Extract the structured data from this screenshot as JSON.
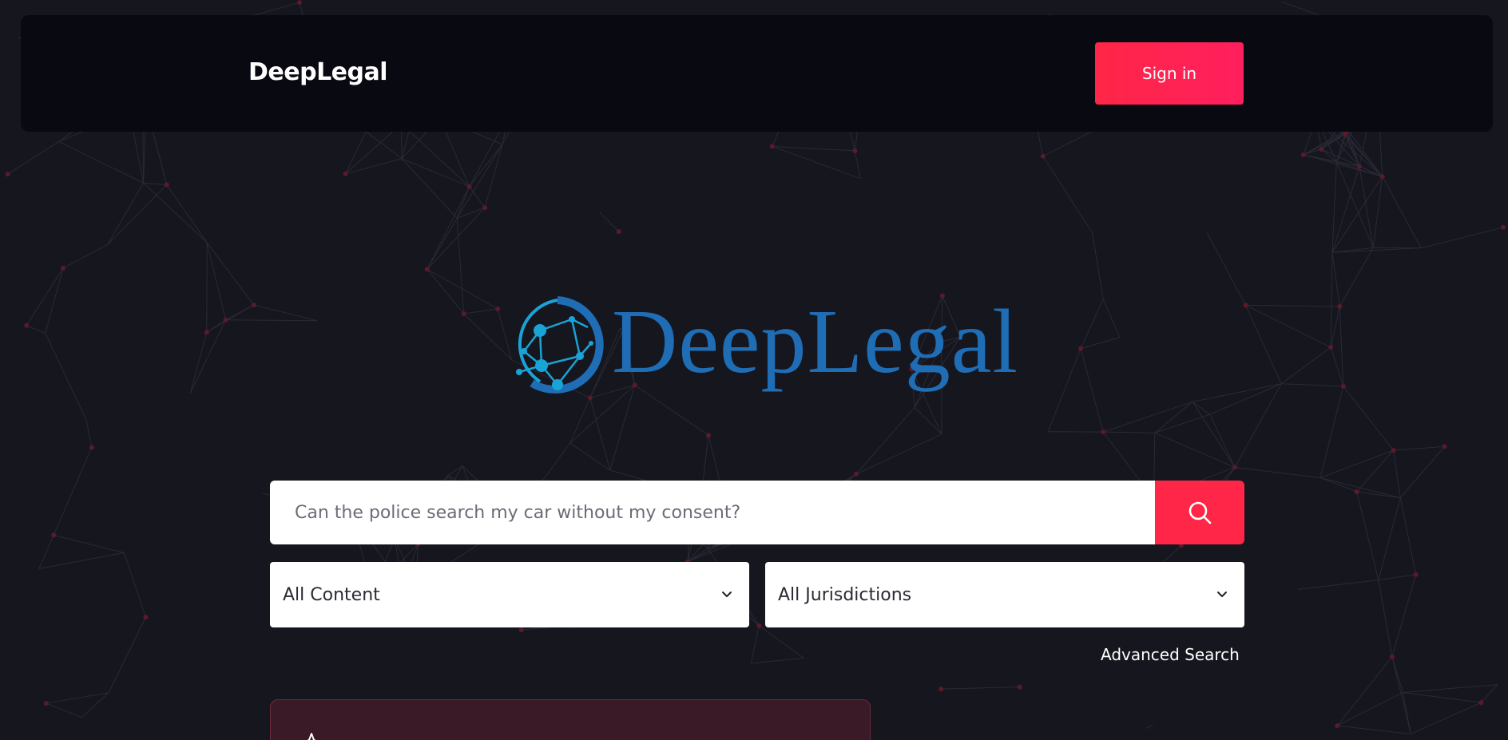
{
  "nav": {
    "brand": "DeepLegal",
    "signin_label": "Sign in"
  },
  "logo": {
    "text": "DeepLegal",
    "color": "#1f6db5",
    "accent": "#1aa3d6"
  },
  "search": {
    "placeholder": "Can the police search my car without my consent?",
    "value": "",
    "button_icon": "search-icon"
  },
  "filters": {
    "content": {
      "selected": "All Content",
      "icon": "chevron-down-icon"
    },
    "jurisdiction": {
      "selected": "All Jurisdictions",
      "icon": "chevron-down-icon"
    }
  },
  "advanced_search_label": "Advanced Search",
  "promo": {
    "icon": "sparkle-icon"
  },
  "colors": {
    "background": "#16161f",
    "navbar": "#090912",
    "accent": "#ff2647",
    "promo": "#3a1a26"
  }
}
